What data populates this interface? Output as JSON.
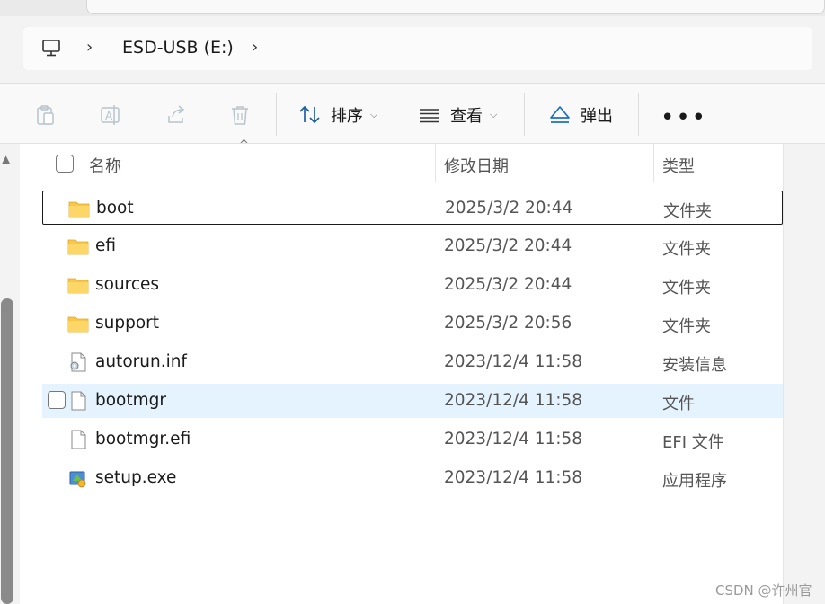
{
  "address": {
    "computer_icon": "pc-icon",
    "path": [
      "ESD-USB (E:)"
    ]
  },
  "commands": {
    "paste": "clipboard-icon",
    "rename": "rename-icon",
    "share": "share-icon",
    "delete": "trash-icon",
    "sort_label": "排序",
    "view_label": "查看",
    "eject_label": "弹出",
    "more_label": "•••"
  },
  "columns": {
    "name": "名称",
    "date": "修改日期",
    "type": "类型"
  },
  "files": [
    {
      "name": "boot",
      "date": "2025/3/2 20:44",
      "type": "文件夹",
      "icon": "folder-icon"
    },
    {
      "name": "efi",
      "date": "2025/3/2 20:44",
      "type": "文件夹",
      "icon": "folder-icon"
    },
    {
      "name": "sources",
      "date": "2025/3/2 20:44",
      "type": "文件夹",
      "icon": "folder-icon"
    },
    {
      "name": "support",
      "date": "2025/3/2 20:56",
      "type": "文件夹",
      "icon": "folder-icon"
    },
    {
      "name": "autorun.inf",
      "date": "2023/12/4 11:58",
      "type": "安装信息",
      "icon": "settings-file-icon"
    },
    {
      "name": "bootmgr",
      "date": "2023/12/4 11:58",
      "type": "文件",
      "icon": "file-icon"
    },
    {
      "name": "bootmgr.efi",
      "date": "2023/12/4 11:58",
      "type": "EFI 文件",
      "icon": "file-icon"
    },
    {
      "name": "setup.exe",
      "date": "2023/12/4 11:58",
      "type": "应用程序",
      "icon": "setup-app-icon"
    }
  ],
  "watermark": "CSDN @许州官",
  "colors": {
    "accent": "#0067c0",
    "hover_row": "#e5f3ff",
    "folder": "#f8c74a"
  }
}
